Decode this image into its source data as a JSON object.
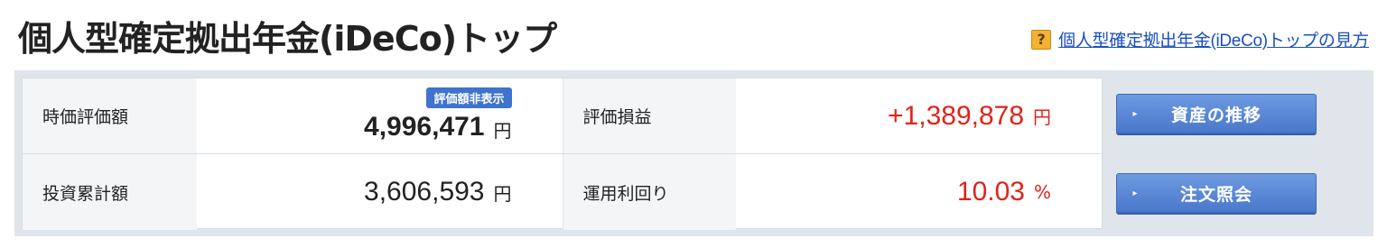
{
  "header": {
    "title": "個人型確定拠出年金(iDeCo)トップ",
    "help_icon": "?",
    "help_link": "個人型確定拠出年金(iDeCo)トップの見方"
  },
  "summary": {
    "market_value": {
      "label": "時価評価額",
      "badge": "評価額非表示",
      "value": "4,996,471",
      "unit": "円"
    },
    "unrealized_pl": {
      "label": "評価損益",
      "value": "+1,389,878",
      "unit": "円"
    },
    "total_contrib": {
      "label": "投資累計額",
      "value": "3,606,593",
      "unit": "円"
    },
    "return_rate": {
      "label": "運用利回り",
      "value": "10.03",
      "unit": "%"
    }
  },
  "buttons": {
    "asset_trend": {
      "label": "資産の推移",
      "icon": "▸"
    },
    "order_inquiry": {
      "label": "注文照会",
      "icon": "▸"
    }
  },
  "colors": {
    "positive": "#e0231b",
    "button": "#4a78cc",
    "link": "#1a4fc2"
  }
}
